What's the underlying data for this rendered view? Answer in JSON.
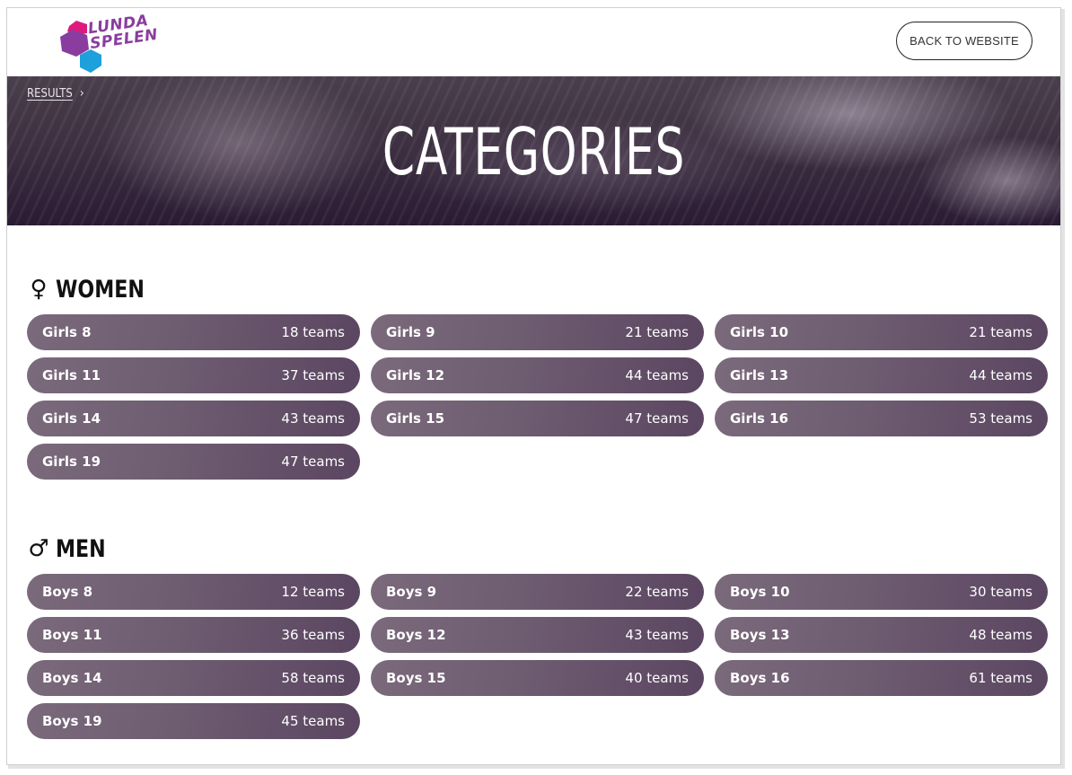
{
  "header": {
    "logo_line1": "LUNDA",
    "logo_line2": "SPELEN",
    "back_label": "BACK TO WEBSITE"
  },
  "hero": {
    "breadcrumb": "RESULTS",
    "title": "CATEGORIES"
  },
  "women": {
    "glyph": "♀",
    "title": "WOMEN",
    "items": [
      {
        "name": "Girls 8",
        "count": "18 teams"
      },
      {
        "name": "Girls 9",
        "count": "21 teams"
      },
      {
        "name": "Girls 10",
        "count": "21 teams"
      },
      {
        "name": "Girls 11",
        "count": "37 teams"
      },
      {
        "name": "Girls 12",
        "count": "44 teams"
      },
      {
        "name": "Girls 13",
        "count": "44 teams"
      },
      {
        "name": "Girls 14",
        "count": "43 teams"
      },
      {
        "name": "Girls 15",
        "count": "47 teams"
      },
      {
        "name": "Girls 16",
        "count": "53 teams"
      },
      {
        "name": "Girls 19",
        "count": "47 teams"
      }
    ]
  },
  "men": {
    "glyph": "♂",
    "title": "MEN",
    "items": [
      {
        "name": "Boys 8",
        "count": "12 teams"
      },
      {
        "name": "Boys 9",
        "count": "22 teams"
      },
      {
        "name": "Boys 10",
        "count": "30 teams"
      },
      {
        "name": "Boys 11",
        "count": "36 teams"
      },
      {
        "name": "Boys 12",
        "count": "43 teams"
      },
      {
        "name": "Boys 13",
        "count": "48 teams"
      },
      {
        "name": "Boys 14",
        "count": "58 teams"
      },
      {
        "name": "Boys 15",
        "count": "40 teams"
      },
      {
        "name": "Boys 16",
        "count": "61 teams"
      },
      {
        "name": "Boys 19",
        "count": "45 teams"
      }
    ]
  },
  "colors": {
    "pill": "#6e5c71",
    "logo_pink": "#e0197d",
    "logo_purple": "#8a3d9e",
    "logo_blue": "#1ea0dc"
  }
}
